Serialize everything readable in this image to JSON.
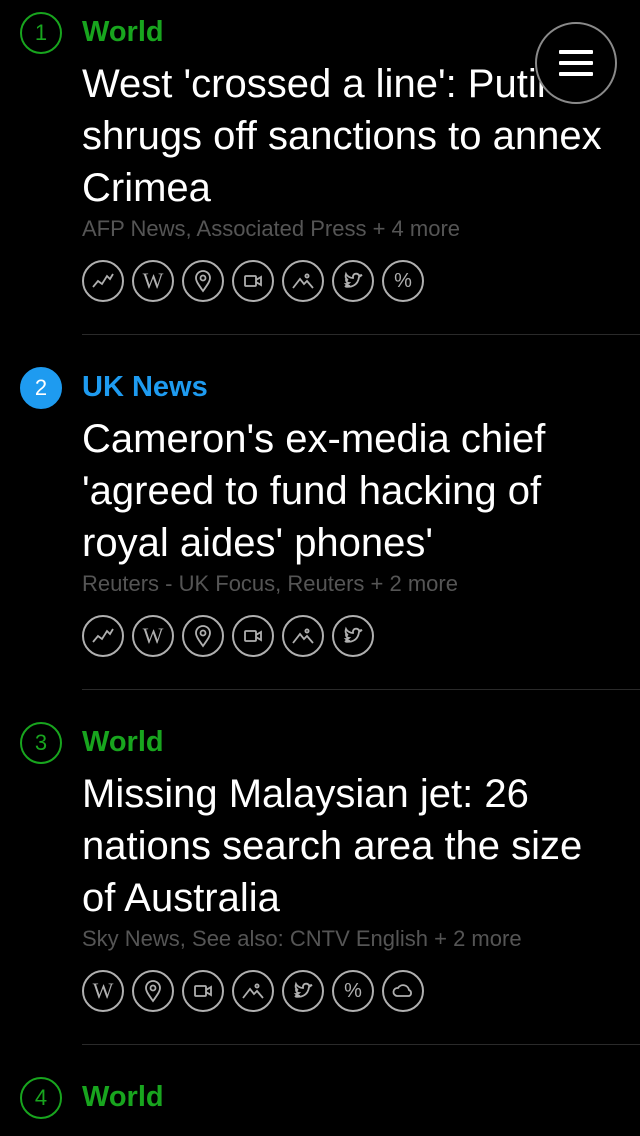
{
  "menu": {
    "icon": "hamburger-menu-icon"
  },
  "stories": [
    {
      "number": "1",
      "category": "World",
      "category_color": "#18a51e",
      "headline": "West 'crossed a line': Putin shrugs off sanctions to annex Crimea",
      "sources": "AFP News, Associated Press + 4 more",
      "icons": [
        "trend-icon",
        "wikipedia-icon",
        "map-pin-icon",
        "video-icon",
        "image-icon",
        "twitter-icon",
        "percent-icon"
      ]
    },
    {
      "number": "2",
      "category": "UK News",
      "category_color": "#1e9bf0",
      "headline": "Cameron's ex-media chief 'agreed to fund hacking of royal aides' phones'",
      "sources": "Reuters - UK Focus, Reuters + 2 more",
      "icons": [
        "trend-icon",
        "wikipedia-icon",
        "map-pin-icon",
        "video-icon",
        "image-icon",
        "twitter-icon"
      ]
    },
    {
      "number": "3",
      "category": "World",
      "category_color": "#18a51e",
      "headline": "Missing Malaysian jet: 26 nations search area the size of Australia",
      "sources": "Sky News, See also: CNTV English + 2 more",
      "icons": [
        "wikipedia-icon",
        "map-pin-icon",
        "video-icon",
        "image-icon",
        "twitter-icon",
        "percent-icon",
        "weather-icon"
      ]
    },
    {
      "number": "4",
      "category": "World",
      "category_color": "#18a51e",
      "headline": "",
      "sources": "",
      "icons": []
    }
  ],
  "icon_glyphs": {
    "wikipedia": "W",
    "percent": "%"
  }
}
